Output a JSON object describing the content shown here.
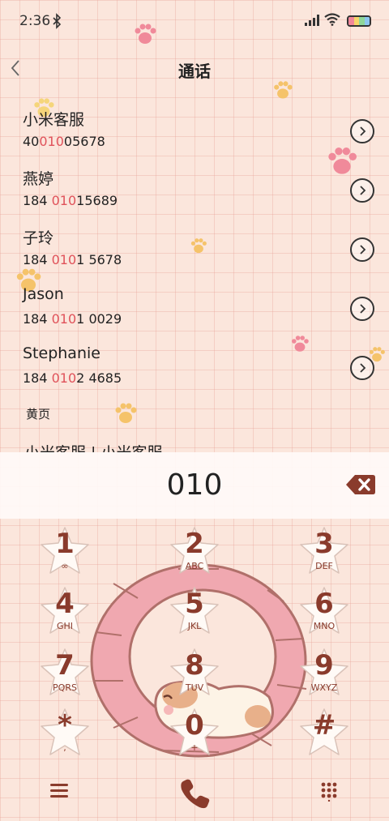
{
  "status": {
    "time": "2:36"
  },
  "header": {
    "title": "通话"
  },
  "contacts": [
    {
      "name": "小米客服",
      "number_pre": "40",
      "number_match": "010",
      "number_post": "05678"
    },
    {
      "name": "燕婷",
      "number_pre": "184 ",
      "number_match": "010",
      "number_post": "15689"
    },
    {
      "name": "子玲",
      "number_pre": "184 ",
      "number_match": "010",
      "number_post": "1 5678"
    },
    {
      "name": "Jason",
      "number_pre": "184 ",
      "number_match": "010",
      "number_post": "1 0029"
    },
    {
      "name": "Stephanie",
      "number_pre": "184 ",
      "number_match": "010",
      "number_post": "2 4685"
    }
  ],
  "yellow_pages": {
    "label": "黄页",
    "partial_entry": "小米客服 | 小米客服"
  },
  "dialer": {
    "input": "010"
  },
  "keys": [
    {
      "digit": "1",
      "letters": "∞"
    },
    {
      "digit": "2",
      "letters": "ABC"
    },
    {
      "digit": "3",
      "letters": "DEF"
    },
    {
      "digit": "4",
      "letters": "GHI"
    },
    {
      "digit": "5",
      "letters": "JKL"
    },
    {
      "digit": "6",
      "letters": "MNO"
    },
    {
      "digit": "7",
      "letters": "PQRS"
    },
    {
      "digit": "8",
      "letters": "TUV"
    },
    {
      "digit": "9",
      "letters": "WXYZ"
    },
    {
      "digit": "*",
      "letters": ","
    },
    {
      "digit": "0",
      "letters": "+"
    },
    {
      "digit": "#",
      "letters": ""
    }
  ],
  "theme": {
    "accent": "#8a3b2c",
    "match": "#e0525a",
    "background": "#fbe6dc",
    "wheel": "#f0a8b0"
  },
  "icons": {
    "back": "chevron-left-icon",
    "backspace": "backspace-icon",
    "menu": "hamburger-menu-icon",
    "call": "phone-icon",
    "dialpad": "dialpad-grid-icon"
  }
}
